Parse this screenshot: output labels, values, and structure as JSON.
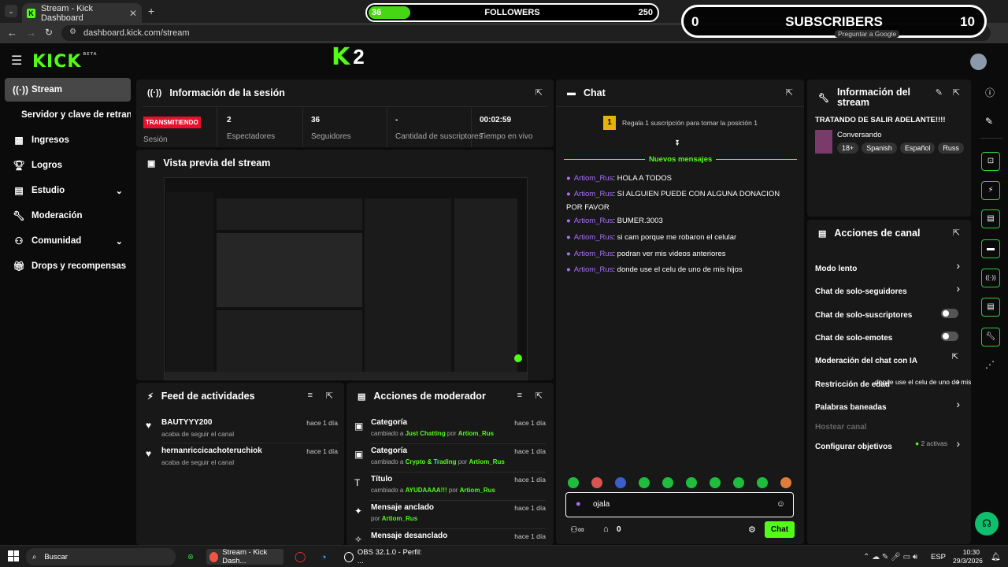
{
  "browser": {
    "tab_title": "Stream - Kick Dashboard",
    "url": "dashboard.kick.com/stream",
    "ask_google": "Preguntar a Google"
  },
  "overlays": {
    "followers_current": "36",
    "followers_label": "FOLLOWERS",
    "followers_goal": "250",
    "followers_progress": 0.144,
    "subs_current": "0",
    "subs_label": "SUBSCRIBERS",
    "subs_goal": "10",
    "k2_label": "2"
  },
  "header": {
    "logo": "KICK",
    "beta": "BETA"
  },
  "sidebar": {
    "items": [
      {
        "label": "Stream",
        "icon": "broadcast-icon"
      },
      {
        "label": "Servidor y clave de retransmisión",
        "icon": ""
      },
      {
        "label": "Ingresos",
        "icon": "revenue-icon"
      },
      {
        "label": "Logros",
        "icon": "trophy-icon"
      },
      {
        "label": "Estudio",
        "icon": "studio-icon"
      },
      {
        "label": "Moderación",
        "icon": "wrench-icon"
      },
      {
        "label": "Comunidad",
        "icon": "community-icon"
      },
      {
        "label": "Drops y recompensas",
        "icon": "gift-icon"
      }
    ]
  },
  "session": {
    "title": "Información de la sesión",
    "status_badge": "TRANSMITIENDO",
    "status_caption": "Sesión",
    "stats": [
      {
        "value": "2",
        "label": "Espectadores"
      },
      {
        "value": "36",
        "label": "Seguidores"
      },
      {
        "value": "-",
        "label": "Cantidad de suscriptores"
      },
      {
        "value": "00:02:59",
        "label": "Tiempo en vivo"
      }
    ]
  },
  "preview": {
    "title": "Vista previa del stream"
  },
  "activity": {
    "title": "Feed de actividades",
    "items": [
      {
        "name": "BAUTYYY200",
        "desc": "acaba de seguir el canal",
        "time": "hace 1 día"
      },
      {
        "name": "hernanriccicachoteruchiok",
        "desc": "acaba de seguir el canal",
        "time": "hace 1 día"
      }
    ]
  },
  "modactions": {
    "title": "Acciones de moderador",
    "items": [
      {
        "title": "Categoría",
        "pre": "cambiado a ",
        "value": "Just Chatting",
        "mid": " por ",
        "user": "Artiom_Rus",
        "time": "hace 1 día"
      },
      {
        "title": "Categoría",
        "pre": "cambiado a ",
        "value": "Crypto & Trading",
        "mid": " por ",
        "user": "Artiom_Rus",
        "time": "hace 1 día"
      },
      {
        "title": "Título",
        "pre": "cambiado a ",
        "value": "AYUDAAAA!!!",
        "mid": " por ",
        "user": "Artiom_Rus",
        "time": "hace 1 día"
      },
      {
        "title": "Mensaje anclado",
        "pre": "por ",
        "value": "",
        "mid": "",
        "user": "Artiom_Rus",
        "time": "hace 1 día"
      },
      {
        "title": "Mensaje desanclado",
        "pre": "",
        "value": "",
        "mid": "",
        "user": "",
        "time": "hace 1 día"
      }
    ]
  },
  "chat": {
    "title": "Chat",
    "gift_rank": "1",
    "gift_text": "Regala 1 suscripción para tomar la posición 1",
    "new_messages": "Nuevos mensajes",
    "messages": [
      {
        "user": "Artiom_Rus",
        "text": "HOLA A TODOS"
      },
      {
        "user": "Artiom_Rus",
        "text": "SI ALGUIEN PUEDE CON ALGUNA DONACION POR FAVOR"
      },
      {
        "user": "Artiom_Rus",
        "text": "BUMER.3003"
      },
      {
        "user": "Artiom_Rus",
        "text": "si cam porque me robaron el celular"
      },
      {
        "user": "Artiom_Rus",
        "text": "podran ver mis videos anteriores"
      },
      {
        "user": "Artiom_Rus",
        "text": "donde use el celu de uno de mis hijos"
      }
    ],
    "input_value": "ojala",
    "points": "0",
    "send_label": "Chat"
  },
  "streaminfo": {
    "title": "Información del stream",
    "stream_title": "TRATANDO DE SALIR ADELANTE!!!!",
    "category": "Conversando",
    "tags": [
      "18+",
      "Spanish",
      "Español",
      "Russ"
    ]
  },
  "channel": {
    "title": "Acciones de canal",
    "items": [
      {
        "label": "Modo lento",
        "control": "chevron"
      },
      {
        "label": "Chat de solo-seguidores",
        "control": "chevron"
      },
      {
        "label": "Chat de solo-suscriptores",
        "control": "toggle"
      },
      {
        "label": "Chat de solo-emotes",
        "control": "toggle"
      },
      {
        "label": "Moderación del chat con IA",
        "control": "external"
      },
      {
        "label": "Restricción de edad",
        "control": "chevron"
      },
      {
        "label": "Palabras baneadas",
        "control": "chevron"
      },
      {
        "label": "Hostear canal",
        "control": "none"
      },
      {
        "label": "Configurar objetivos",
        "control": "chevron"
      }
    ],
    "overlap_text": "donde use el celu de uno de mis hijos",
    "goals_badge": "2 activas"
  },
  "taskbar": {
    "search": "Buscar",
    "chrome_label": "Stream - Kick Dash...",
    "obs_label": "OBS 32.1.0 - Perfil: ...",
    "lang": "ESP",
    "time": "10:30",
    "date": "29/3/2026"
  },
  "colors": {
    "accent": "#53fc18",
    "live": "#e8102c",
    "user": "#a970ff"
  }
}
